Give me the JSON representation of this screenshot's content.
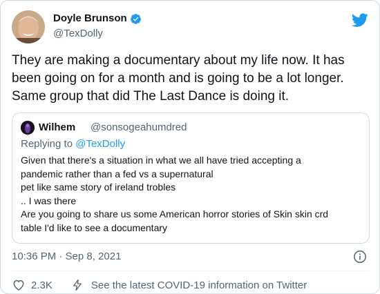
{
  "author": {
    "name": "Doyle Brunson",
    "handle": "@TexDolly",
    "verified": true
  },
  "tweet": {
    "text": "They are making a documentary about my life now. It has been going on for a month and is going to be a lot longer. Same group that did The Last Dance is doing it.",
    "timestamp": "10:36 PM · Sep 8, 2021"
  },
  "quoted": {
    "name": "Wilhem",
    "handle": "@sonsogeahumdred",
    "replying_prefix": "Replying to ",
    "replying_to": "@TexDolly",
    "text": "Given that there's a situation in what we all have tried accepting a\npandemic rather than a fed vs a supernatural\npet like same story of ireland trobles\n..  I was there\nAre you going to share us some American horror stories of Skin skin crd\ntable I'd like to see a documentary"
  },
  "actions": {
    "like_count": "2.3K",
    "covid_info": "See the latest COVID-19 information on Twitter"
  },
  "icons": {
    "twitter": "twitter-bird-icon",
    "verified": "verified-badge-icon",
    "info": "info-icon",
    "like": "heart-icon",
    "covid": "lightning-bolt-icon"
  },
  "colors": {
    "brand_blue": "#1d9bf0",
    "secondary_text": "#536471",
    "border": "#cfd9de"
  }
}
